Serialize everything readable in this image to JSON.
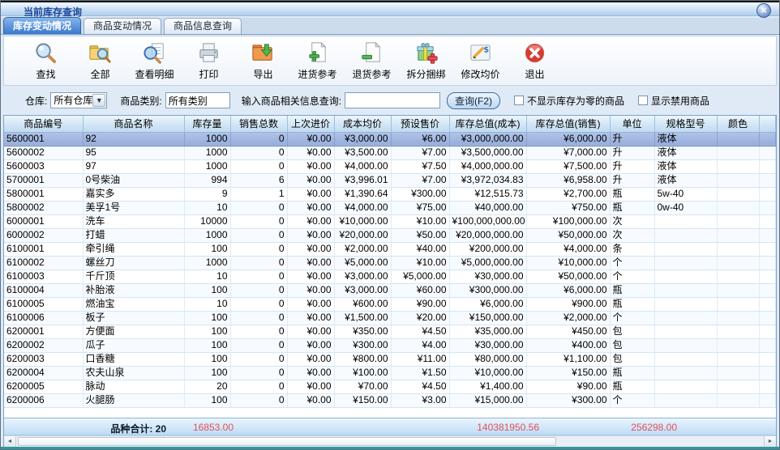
{
  "window": {
    "title": "当前库存查询"
  },
  "tabs": [
    {
      "label": "库存变动情况",
      "active": true
    },
    {
      "label": "商品变动情况",
      "active": false
    },
    {
      "label": "商品信息查询",
      "active": false
    }
  ],
  "toolbar": {
    "buttons": [
      {
        "label": "查找",
        "icon": "search-icon"
      },
      {
        "label": "全部",
        "icon": "folder-search-icon"
      },
      {
        "label": "查看明细",
        "icon": "view-detail-icon"
      },
      {
        "label": "打印",
        "icon": "print-icon"
      },
      {
        "label": "导出",
        "icon": "export-icon"
      },
      {
        "label": "进货参考",
        "icon": "purchase-reference-icon"
      },
      {
        "label": "退货参考",
        "icon": "return-reference-icon"
      },
      {
        "label": "拆分捆绑",
        "icon": "split-bundle-icon"
      },
      {
        "label": "修改均价",
        "icon": "modify-price-icon"
      },
      {
        "label": "退出",
        "icon": "exit-icon"
      }
    ]
  },
  "filters": {
    "warehouse_label": "仓库:",
    "warehouse_value": "所有仓库",
    "category_label": "商品类别:",
    "category_value": "所有类别",
    "search_label": "输入商品相关信息查询:",
    "search_value": "",
    "query_button": "查询(F2)",
    "checkbox_hide_zero": "不显示库存为零的商品",
    "checkbox_show_disabled": "显示禁用商品"
  },
  "table": {
    "columns": [
      "商品编号",
      "商品名称",
      "库存量",
      "销售总数",
      "上次进价",
      "成本均价",
      "预设售价",
      "库存总值(成本)",
      "库存总值(销售)",
      "单位",
      "规格型号",
      "颜色"
    ],
    "selected_row_index": 0,
    "rows": [
      [
        "5600001",
        "92",
        "1000",
        "0",
        "¥0.00",
        "¥3,000.00",
        "¥6.00",
        "¥3,000,000.00",
        "¥6,000.00",
        "升",
        "液体",
        ""
      ],
      [
        "5600002",
        "95",
        "1000",
        "0",
        "¥0.00",
        "¥3,500.00",
        "¥7.00",
        "¥3,500,000.00",
        "¥7,000.00",
        "升",
        "液体",
        ""
      ],
      [
        "5600003",
        "97",
        "1000",
        "0",
        "¥0.00",
        "¥4,000.00",
        "¥7.50",
        "¥4,000,000.00",
        "¥7,500.00",
        "升",
        "液体",
        ""
      ],
      [
        "5700001",
        "0号柴油",
        "994",
        "6",
        "¥0.00",
        "¥3,996.01",
        "¥7.00",
        "¥3,972,034.83",
        "¥6,958.00",
        "升",
        "液体",
        ""
      ],
      [
        "5800001",
        "嘉实多",
        "9",
        "1",
        "¥0.00",
        "¥1,390.64",
        "¥300.00",
        "¥12,515.73",
        "¥2,700.00",
        "瓶",
        "5w-40",
        ""
      ],
      [
        "5800002",
        "美孚1号",
        "10",
        "0",
        "¥0.00",
        "¥4,000.00",
        "¥75.00",
        "¥40,000.00",
        "¥750.00",
        "瓶",
        "0w-40",
        ""
      ],
      [
        "6000001",
        "洗车",
        "10000",
        "0",
        "¥0.00",
        "¥10,000.00",
        "¥10.00",
        "¥100,000,000.00",
        "¥100,000.00",
        "次",
        "",
        ""
      ],
      [
        "6000002",
        "打蜡",
        "1000",
        "0",
        "¥0.00",
        "¥20,000.00",
        "¥50.00",
        "¥20,000,000.00",
        "¥50,000.00",
        "次",
        "",
        ""
      ],
      [
        "6100001",
        "牵引绳",
        "100",
        "0",
        "¥0.00",
        "¥2,000.00",
        "¥40.00",
        "¥200,000.00",
        "¥4,000.00",
        "条",
        "",
        ""
      ],
      [
        "6100002",
        "螺丝刀",
        "1000",
        "0",
        "¥0.00",
        "¥5,000.00",
        "¥10.00",
        "¥5,000,000.00",
        "¥10,000.00",
        "个",
        "",
        ""
      ],
      [
        "6100003",
        "千斤顶",
        "10",
        "0",
        "¥0.00",
        "¥3,000.00",
        "¥5,000.00",
        "¥30,000.00",
        "¥50,000.00",
        "个",
        "",
        ""
      ],
      [
        "6100004",
        "补胎液",
        "100",
        "0",
        "¥0.00",
        "¥3,000.00",
        "¥60.00",
        "¥300,000.00",
        "¥6,000.00",
        "瓶",
        "",
        ""
      ],
      [
        "6100005",
        "燃油宝",
        "10",
        "0",
        "¥0.00",
        "¥600.00",
        "¥90.00",
        "¥6,000.00",
        "¥900.00",
        "瓶",
        "",
        ""
      ],
      [
        "6100006",
        "板子",
        "100",
        "0",
        "¥0.00",
        "¥1,500.00",
        "¥20.00",
        "¥150,000.00",
        "¥2,000.00",
        "个",
        "",
        ""
      ],
      [
        "6200001",
        "方便面",
        "100",
        "0",
        "¥0.00",
        "¥350.00",
        "¥4.50",
        "¥35,000.00",
        "¥450.00",
        "包",
        "",
        ""
      ],
      [
        "6200002",
        "瓜子",
        "100",
        "0",
        "¥0.00",
        "¥300.00",
        "¥4.00",
        "¥30,000.00",
        "¥400.00",
        "包",
        "",
        ""
      ],
      [
        "6200003",
        "口香糖",
        "100",
        "0",
        "¥0.00",
        "¥800.00",
        "¥11.00",
        "¥80,000.00",
        "¥1,100.00",
        "包",
        "",
        ""
      ],
      [
        "6200004",
        "农夫山泉",
        "100",
        "0",
        "¥0.00",
        "¥100.00",
        "¥1.50",
        "¥10,000.00",
        "¥150.00",
        "瓶",
        "",
        ""
      ],
      [
        "6200005",
        "脉动",
        "20",
        "0",
        "¥0.00",
        "¥70.00",
        "¥4.50",
        "¥1,400.00",
        "¥90.00",
        "瓶",
        "",
        ""
      ],
      [
        "6200006",
        "火腿肠",
        "100",
        "0",
        "¥0.00",
        "¥150.00",
        "¥3.00",
        "¥15,000.00",
        "¥300.00",
        "个",
        "",
        ""
      ]
    ]
  },
  "summary": {
    "label": "品种合计: 20",
    "stock_total": "16853.00",
    "cost_value_total": "140381950.56",
    "sale_value_total": "256298.00"
  }
}
